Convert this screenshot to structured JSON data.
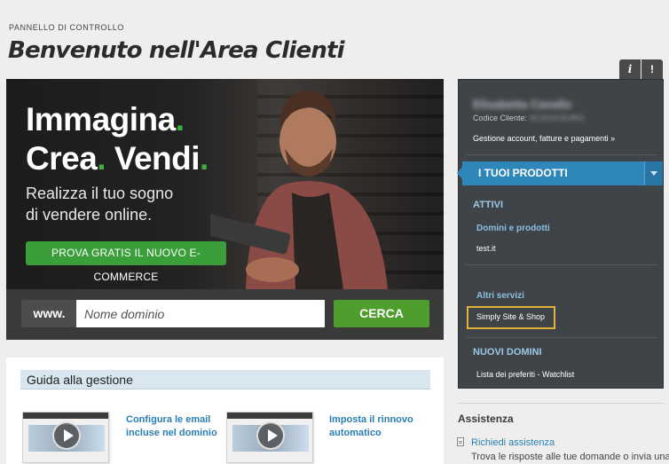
{
  "header": {
    "breadcrumb": "PANNELLO DI CONTROLLO",
    "title": "Benvenuto nell'Area Clienti"
  },
  "banner": {
    "line1": "Immagina",
    "line2a": "Crea",
    "line2b": "Vendi",
    "dot": ".",
    "subtitle1": "Realizza il tuo sogno",
    "subtitle2": "di vendere online.",
    "promo_button": "PROVA GRATIS IL NUOVO E-COMMERCE",
    "accent_color": "#3fb040"
  },
  "search": {
    "prefix": "www.",
    "placeholder": "Nome dominio",
    "button": "CERCA"
  },
  "guide": {
    "title": "Guida alla gestione",
    "items": [
      {
        "label1": "Configura le email",
        "label2": "incluse nel dominio",
        "icon": "video-play-icon"
      },
      {
        "label1": "Imposta il rinnovo",
        "label2": "automatico",
        "icon": "video-play-icon"
      }
    ]
  },
  "panel": {
    "tabs": {
      "info": "i",
      "alert": "!"
    },
    "user_name": "Elisabetta Cavallo",
    "code_label": "Codice Cliente:",
    "code_value": "SC1014-EURO",
    "account_link": "Gestione account, fatture e pagamenti »",
    "products_header": "I TUOI PRODOTTI",
    "active_label": "ATTIVI",
    "domains_label": "Domini e prodotti",
    "domain_item": "test.it",
    "other_label": "Altri servizi",
    "other_item": "Simply Site & Shop",
    "new_domains_label": "NUOVI DOMINI",
    "watchlist_item": "Lista dei preferiti - Watchlist"
  },
  "assistance": {
    "title": "Assistenza",
    "link": "Richiedi assistenza",
    "text": "Trova le risposte alle tue domande o invia una"
  }
}
